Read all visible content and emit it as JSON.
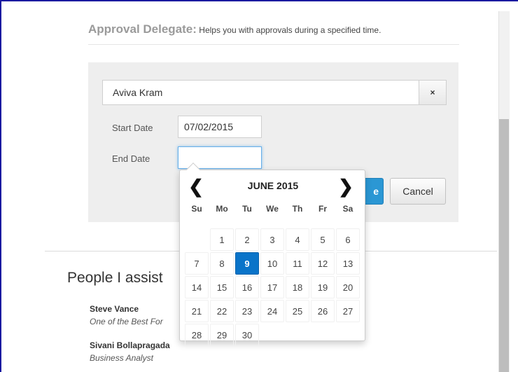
{
  "header": {
    "title": "Approval Delegate:",
    "subtitle": "Helps you with approvals during a specified time."
  },
  "form": {
    "delegate_value": "Aviva Kram",
    "clear_label": "×",
    "start_label": "Start Date",
    "start_value": "07/02/2015",
    "end_label": "End Date",
    "end_value": "",
    "save_label": "e",
    "cancel_label": "Cancel"
  },
  "datepicker": {
    "month_label": "JUNE 2015",
    "prev_label": "❮",
    "next_label": "❯",
    "weekdays": [
      "Su",
      "Mo",
      "Tu",
      "We",
      "Th",
      "Fr",
      "Sa"
    ],
    "first_weekday_index": 1,
    "days_in_month": 30,
    "selected_day": 9,
    "accent_color": "#0a74c9"
  },
  "people": {
    "section_title": "People I assist",
    "items": [
      {
        "name": "Steve Vance",
        "role": "One of the Best For"
      },
      {
        "name": "Sivani Bollapragada",
        "role": "Business Analyst"
      }
    ]
  }
}
